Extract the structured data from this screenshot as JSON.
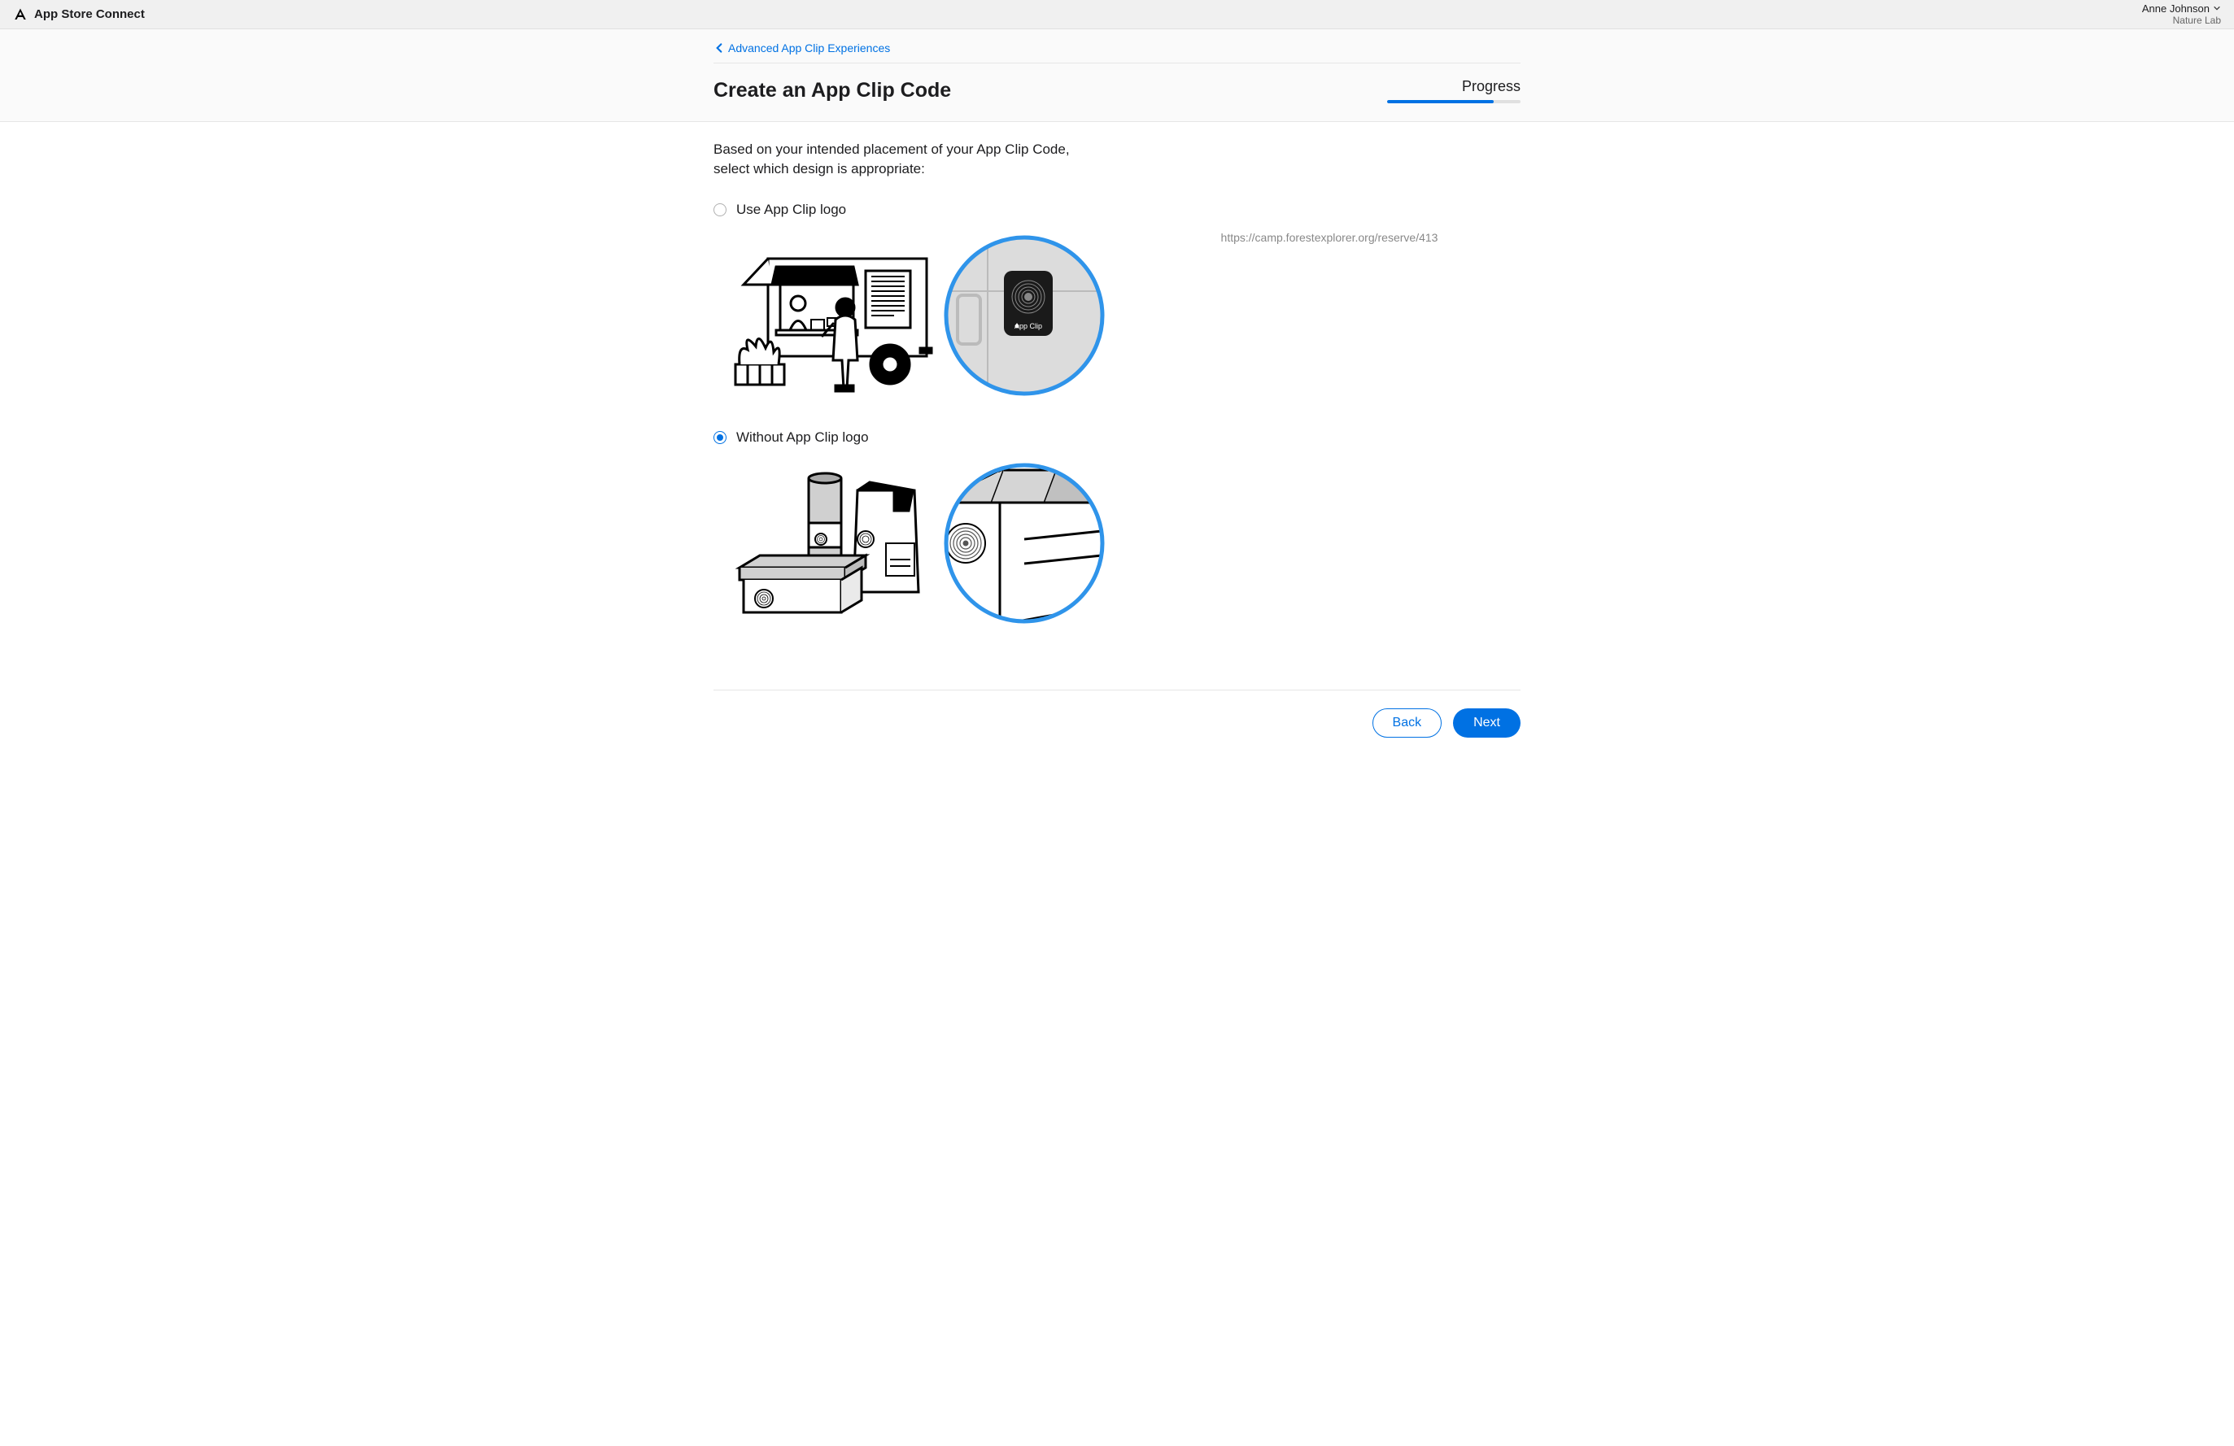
{
  "header": {
    "app_title": "App Store Connect",
    "user_name": "Anne Johnson",
    "org_name": "Nature Lab"
  },
  "breadcrumb": {
    "label": "Advanced App Clip Experiences"
  },
  "page": {
    "title": "Create an App Clip Code",
    "progress_label": "Progress",
    "progress_percent": 80
  },
  "form": {
    "instruction": "Based on your intended placement of your App Clip Code, select which design is appropriate:",
    "options": [
      {
        "id": "use-logo",
        "label": "Use App Clip logo",
        "selected": false
      },
      {
        "id": "without-logo",
        "label": "Without App Clip logo",
        "selected": true
      }
    ]
  },
  "preview": {
    "url": "https://camp.forestexplorer.org/reserve/413"
  },
  "footer": {
    "back_label": "Back",
    "next_label": "Next"
  }
}
